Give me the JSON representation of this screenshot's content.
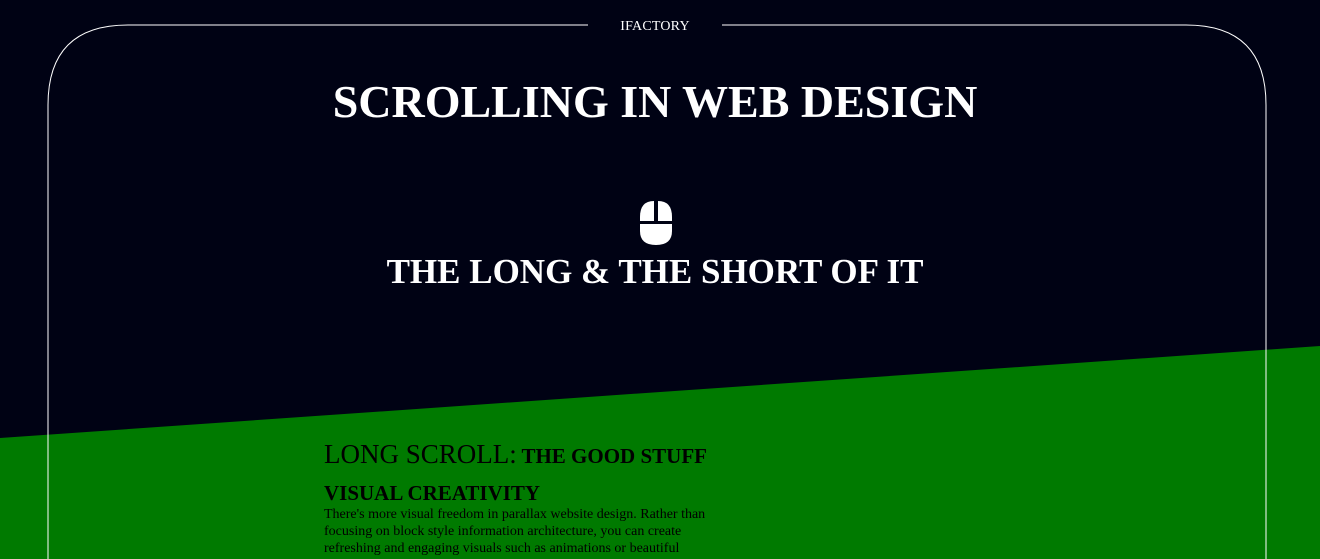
{
  "brand": {
    "name": "IFACTORY"
  },
  "hero": {
    "title": "SCROLLING IN WEB DESIGN",
    "subtitle": "THE LONG & THE SHORT OF IT",
    "scroll_icon": "mouse-icon"
  },
  "section": {
    "heading_main": "LONG SCROLL:",
    "heading_sub": "THE GOOD STUFF",
    "feature": {
      "title": "VISUAL CREATIVITY",
      "text": "There's more visual freedom in parallax website design. Rather than focusing on block style information architecture, you can create refreshing and engaging visuals such as animations or beautiful photography that act as a continuous, ultimately engaging way to"
    }
  },
  "colors": {
    "background": "#000214",
    "accent_green": "#007a00",
    "frame_line": "#ffffff",
    "text_light": "#ffffff",
    "text_dark": "#000000"
  }
}
